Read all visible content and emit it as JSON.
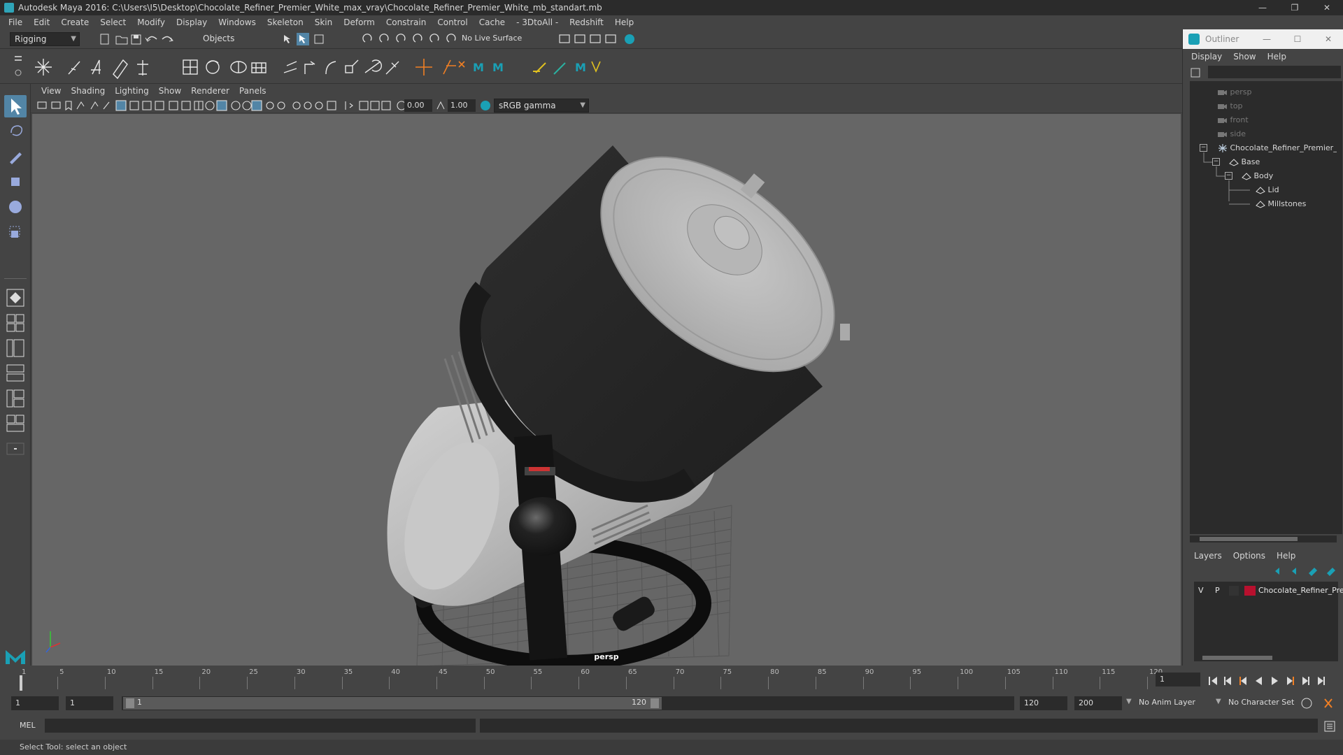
{
  "window": {
    "title": "Autodesk Maya 2016: C:\\Users\\I5\\Desktop\\Chocolate_Refiner_Premier_White_max_vray\\Chocolate_Refiner_Premier_White_mb_standart.mb",
    "minimize": "—",
    "restore": "❐",
    "close": "✕"
  },
  "menubar": [
    "File",
    "Edit",
    "Create",
    "Select",
    "Modify",
    "Display",
    "Windows",
    "Skeleton",
    "Skin",
    "Deform",
    "Constrain",
    "Control",
    "Cache",
    "- 3DtoAll -",
    "Redshift",
    "Help"
  ],
  "statusline": {
    "mode": "Rigging",
    "selection_mode": "Objects",
    "live_surface": "No Live Surface"
  },
  "panel": {
    "menu": [
      "View",
      "Shading",
      "Lighting",
      "Show",
      "Renderer",
      "Panels"
    ],
    "exposure": "0.00",
    "gamma": "1.00",
    "colorspace": "sRGB gamma",
    "camera_label": "persp"
  },
  "outliner": {
    "title": "Outliner",
    "minimize": "—",
    "maximize": "☐",
    "close": "✕",
    "menu": [
      "Display",
      "Show",
      "Help"
    ],
    "items": [
      {
        "label": "persp",
        "kind": "camera"
      },
      {
        "label": "top",
        "kind": "camera"
      },
      {
        "label": "front",
        "kind": "camera"
      },
      {
        "label": "side",
        "kind": "camera"
      },
      {
        "label": "Chocolate_Refiner_Premier_W",
        "kind": "group"
      },
      {
        "label": "Base",
        "kind": "mesh"
      },
      {
        "label": "Body",
        "kind": "mesh"
      },
      {
        "label": "Lid",
        "kind": "mesh"
      },
      {
        "label": "Millstones",
        "kind": "mesh"
      }
    ]
  },
  "layers": {
    "menu": [
      "Layers",
      "Options",
      "Help"
    ],
    "row": {
      "v": "V",
      "p": "P",
      "name": "Chocolate_Refiner_Pre",
      "color": "#b8102e"
    }
  },
  "timeline": {
    "ticks": [
      "1",
      "5",
      "10",
      "15",
      "20",
      "25",
      "30",
      "35",
      "40",
      "45",
      "50",
      "55",
      "60",
      "65",
      "70",
      "75",
      "80",
      "85",
      "90",
      "95",
      "100",
      "105",
      "110",
      "115",
      "120"
    ],
    "current_frame": "1"
  },
  "range": {
    "start": "1",
    "playback_start": "1",
    "slider_start": "1",
    "slider_end": "120",
    "playback_end": "120",
    "end": "200",
    "anim_layer": "No Anim Layer",
    "character_set": "No Character Set"
  },
  "cmdline": {
    "label": "MEL"
  },
  "helpline": {
    "text": "Select Tool: select an object"
  },
  "colors": {
    "accent": "#5285a6",
    "maya_teal": "#1aa0b5",
    "layer_red": "#b8102e"
  }
}
